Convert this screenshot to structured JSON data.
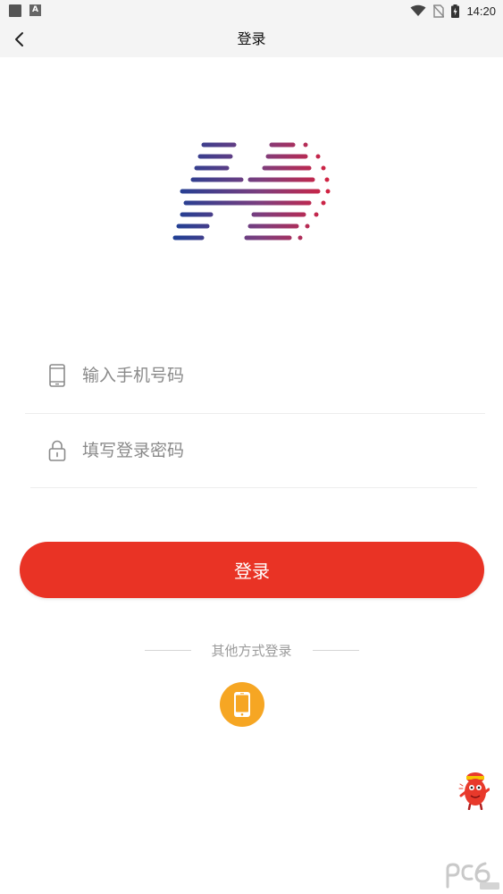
{
  "status_bar": {
    "time": "14:20",
    "icons": [
      "square-icon",
      "a-badge-icon",
      "wifi-icon",
      "no-sim-icon",
      "battery-charging-icon"
    ]
  },
  "nav": {
    "title": "登录",
    "back_icon": "chevron-left-icon"
  },
  "form": {
    "phone": {
      "placeholder": "输入手机号码",
      "value": "",
      "icon": "phone-icon"
    },
    "password": {
      "placeholder": "填写登录密码",
      "value": "",
      "icon": "lock-icon"
    }
  },
  "login_button": {
    "label": "登录",
    "color": "#e93325"
  },
  "other_login": {
    "label": "其他方式登录",
    "phone_option_icon": "smartphone-icon",
    "phone_option_color": "#f6a623"
  },
  "colors": {
    "accent": "#e93325",
    "logo_blue": "#1f3f9a",
    "logo_red": "#d9203a"
  }
}
